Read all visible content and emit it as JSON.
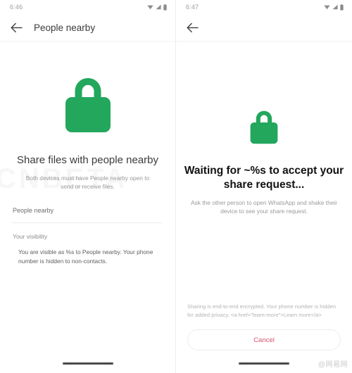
{
  "meta": {
    "watermark": "@网易网"
  },
  "left_panel": {
    "status": {
      "time": "6:46",
      "icons": [
        "wifi-icon",
        "signal-icon",
        "battery-icon"
      ]
    },
    "app_bar": {
      "back_icon": "back-arrow-icon",
      "title": "People nearby"
    },
    "hero": {
      "icon": "lock-icon",
      "color": "#22a75d"
    },
    "headline": "Share files with people nearby",
    "subtext": "Both devices must have People nearby open to send or receive files.",
    "rows": [
      {
        "label": "People nearby"
      }
    ],
    "section": {
      "label": "Your visibility",
      "body": "You are visible as %s to People nearby. Your phone number is hidden to non-contacts."
    }
  },
  "right_panel": {
    "status": {
      "time": "6:47",
      "icons": [
        "wifi-icon",
        "signal-icon",
        "battery-icon"
      ]
    },
    "app_bar": {
      "back_icon": "back-arrow-icon",
      "title": ""
    },
    "hero": {
      "icon": "lock-icon",
      "color": "#22a75d"
    },
    "headline": "Waiting for ~%s to accept your share request...",
    "subtext": "Ask the other person to open WhatsApp and shake their device to see your share request.",
    "footer_note": "Sharing is end-to-end encrypted. Your phone number is hidden for added privacy. <a href=\"learn-more\">Learn more</a>",
    "cancel_label": "Cancel",
    "cancel_color": "#d4576b"
  }
}
